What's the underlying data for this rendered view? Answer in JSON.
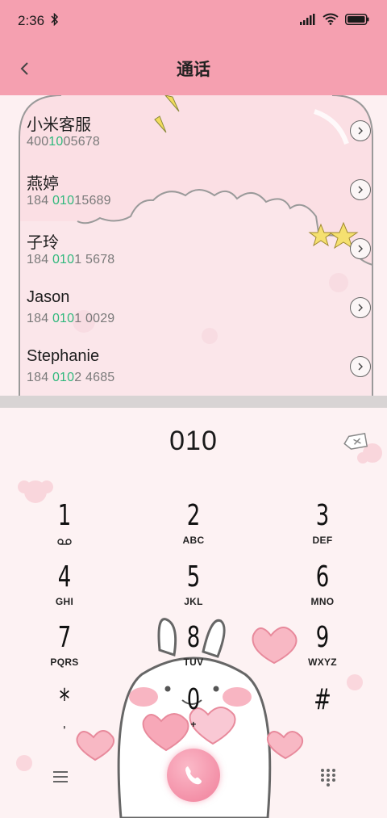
{
  "status_bar": {
    "time": "2:36"
  },
  "header": {
    "title": "通话"
  },
  "contacts": [
    {
      "name": "小米客服",
      "num_pre": "400",
      "num_match": "10",
      "num_post": "05678"
    },
    {
      "name": "燕婷",
      "num_pre": "184 ",
      "num_match": "010",
      "num_post": "15689"
    },
    {
      "name": "子玲",
      "num_pre": "184 ",
      "num_match": "010",
      "num_post": "1 5678"
    },
    {
      "name": "Jason",
      "num_pre": "184 ",
      "num_match": "010",
      "num_post": "1 0029"
    },
    {
      "name": "Stephanie",
      "num_pre": "184 ",
      "num_match": "010",
      "num_post": "2 4685"
    }
  ],
  "dialer": {
    "digits": "010",
    "keys": [
      {
        "digit": "1",
        "letters": ""
      },
      {
        "digit": "2",
        "letters": "ABC"
      },
      {
        "digit": "3",
        "letters": "DEF"
      },
      {
        "digit": "4",
        "letters": "GHI"
      },
      {
        "digit": "5",
        "letters": "JKL"
      },
      {
        "digit": "6",
        "letters": "MNO"
      },
      {
        "digit": "7",
        "letters": "PQRS"
      },
      {
        "digit": "8",
        "letters": "TUV"
      },
      {
        "digit": "9",
        "letters": "WXYZ"
      },
      {
        "digit": "*",
        "letters": ","
      },
      {
        "digit": "0",
        "letters": "+"
      },
      {
        "digit": "#",
        "letters": ""
      }
    ]
  },
  "colors": {
    "theme_pink": "#f5a0b0",
    "match_green": "#2fb87c",
    "call_pink": "#f07f9a"
  },
  "icons": {
    "back": "chevron-left-icon",
    "detail": "chevron-right-icon",
    "backspace": "backspace-icon",
    "voicemail": "voicemail-icon",
    "menu": "menu-icon",
    "call": "phone-icon",
    "keypad": "dialpad-icon"
  }
}
